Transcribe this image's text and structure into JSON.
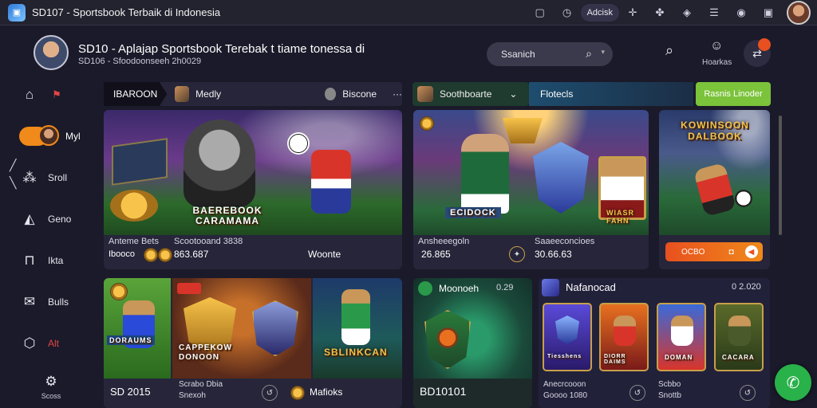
{
  "window": {
    "title": "SD107 - Sportsbook Terbaik di Indonesia",
    "pill_label": "Adcisk"
  },
  "header": {
    "title": "SD10 - Aplajap Sportsbook Terebak t tiame tonessa di",
    "subtitle": "SD106 - Sfoodoonseeh 2h0029",
    "search_placeholder": "Ssanich",
    "notif_label": "Hoarkas"
  },
  "sidebar": {
    "items": [
      {
        "label": "",
        "icon": "home-icon"
      },
      {
        "label": "Myl",
        "icon": "avatar"
      },
      {
        "label": "Sroll",
        "icon": "network-icon"
      },
      {
        "label": "Geno",
        "icon": "cap-icon"
      },
      {
        "label": "Ikta",
        "icon": "inbox-icon"
      },
      {
        "label": "Bulls",
        "icon": "check-icon"
      },
      {
        "label": "Alt",
        "icon": "hexagon-icon"
      },
      {
        "label": "Scoss",
        "icon": "settings-icon"
      }
    ]
  },
  "tabs_left": {
    "dark_tab": "IBAROON",
    "tab1": "Medly",
    "tab2": "Biscone",
    "more": "···"
  },
  "tabs_right": {
    "tab1": "Soothboarte",
    "tab2": "Flotecls",
    "button": "Rasnis Linoder"
  },
  "cards": {
    "hero1": {
      "art_text": "BAEREBOOK CARAMAMA",
      "meta_title1": "Anteme Bets",
      "meta_title2": "Scootooand 3838",
      "val1": "Ibooco",
      "val2": "863.687",
      "val3": "Woonte"
    },
    "hero2": {
      "art_text": "ECIDOCK",
      "badge": "WIASR FAHN",
      "meta_title1": "Ansheeegoln",
      "meta_title2": "Saaeeconcioes",
      "val1": "26.865",
      "val2": "30.66.63"
    },
    "hero3": {
      "art_text": "KOWINSOON DALBOOK",
      "btn_label": "OCBO"
    },
    "row2a": {
      "art_text1": "DORAUMS",
      "art_text2": "CAPPEKOW DONOON",
      "art_text3": "SBLINKCAN",
      "val1": "SD 2015",
      "meta_title": "Scrabo Dbia",
      "meta_sub": "Snexoh",
      "val2": "Mafioks"
    },
    "row2b": {
      "title": "Moonoeh",
      "count": "0.29",
      "val1": "BD10101"
    },
    "row2c": {
      "title": "Nafanocad",
      "count": "0 2.020",
      "mini": [
        "Tiesshens",
        "DIORR DAIMS",
        "DOMAN",
        "CACARA"
      ],
      "meta1": "Anecrcooon",
      "meta1b": "Goooo 1080",
      "meta2": "Scbbo",
      "meta2b": "Snottb"
    }
  },
  "colors": {
    "bg": "#1b1a2a",
    "accent_orange": "#f08a1a",
    "accent_green": "#7bc33a",
    "fab_green": "#29b14a"
  }
}
